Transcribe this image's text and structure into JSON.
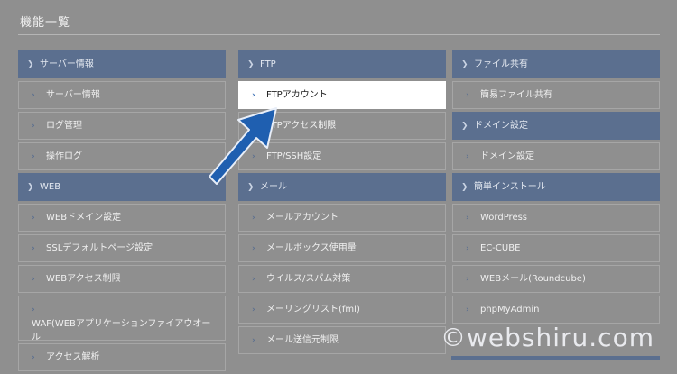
{
  "page": {
    "title": "機能一覧"
  },
  "columns": [
    {
      "sections": [
        {
          "header": "サーバー情報",
          "items": [
            "サーバー情報",
            "ログ管理",
            "操作ログ"
          ]
        },
        {
          "header": "WEB",
          "items": [
            "WEBドメイン設定",
            "SSLデフォルトページ設定",
            "WEBアクセス制限",
            "WAF(WEBアプリケーションファイアウオール",
            "アクセス解析"
          ]
        }
      ]
    },
    {
      "sections": [
        {
          "header": "FTP",
          "items": [
            "FTPアカウント",
            "FTPアクセス制限",
            "FTP/SSH設定"
          ]
        },
        {
          "header": "メール",
          "items": [
            "メールアカウント",
            "メールボックス使用量",
            "ウイルス/スパム対策",
            "メーリングリスト(fml)",
            "メール送信元制限"
          ]
        }
      ]
    },
    {
      "sections": [
        {
          "header": "ファイル共有",
          "items": [
            "簡易ファイル共有"
          ]
        },
        {
          "header": "ドメイン設定",
          "items": [
            "ドメイン設定"
          ]
        },
        {
          "header": "簡単インストール",
          "items": [
            "WordPress",
            "EC-CUBE",
            "WEBメール(Roundcube)",
            "phpMyAdmin"
          ]
        }
      ]
    }
  ],
  "highlight": {
    "item": "FTPアカウント"
  },
  "watermark": "©webshiru.com",
  "colors": {
    "header": "#5b6f8f",
    "overlay": "#8f8f8f",
    "arrow": "#1f5fb0"
  }
}
